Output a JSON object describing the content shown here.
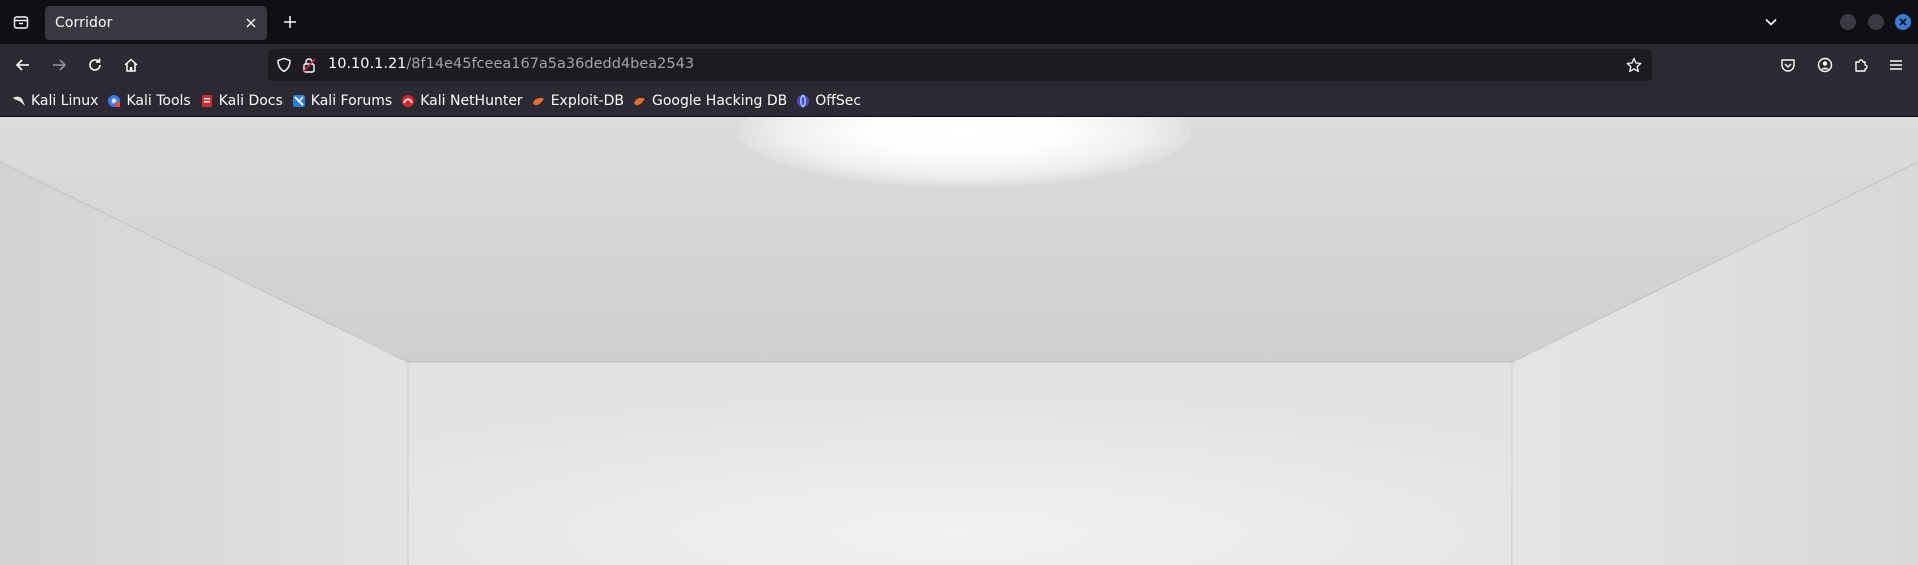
{
  "tabs": [
    {
      "title": "Corridor",
      "active": true
    }
  ],
  "navigation": {
    "url_host": "10.10.1.21",
    "url_path": "/8f14e45fceea167a5a36dedd4bea2543"
  },
  "bookmarks": [
    {
      "label": "Kali Linux",
      "icon": "kali-dragon-icon"
    },
    {
      "label": "Kali Tools",
      "icon": "kali-tools-icon"
    },
    {
      "label": "Kali Docs",
      "icon": "kali-docs-icon"
    },
    {
      "label": "Kali Forums",
      "icon": "kali-forums-icon"
    },
    {
      "label": "Kali NetHunter",
      "icon": "nethunter-icon"
    },
    {
      "label": "Exploit-DB",
      "icon": "exploit-db-icon"
    },
    {
      "label": "Google Hacking DB",
      "icon": "ghdb-icon"
    },
    {
      "label": "OffSec",
      "icon": "offsec-icon"
    }
  ],
  "colors": {
    "tabstrip_bg": "#0f0f14",
    "toolbar_bg": "#2b2a33",
    "urlbar_bg": "#1c1b22",
    "active_tab_bg": "#3a3942",
    "close_button": "#3a7bd5",
    "room_wall": "#d6d6d4"
  },
  "content": {
    "scene": "white empty room with ceiling light"
  }
}
